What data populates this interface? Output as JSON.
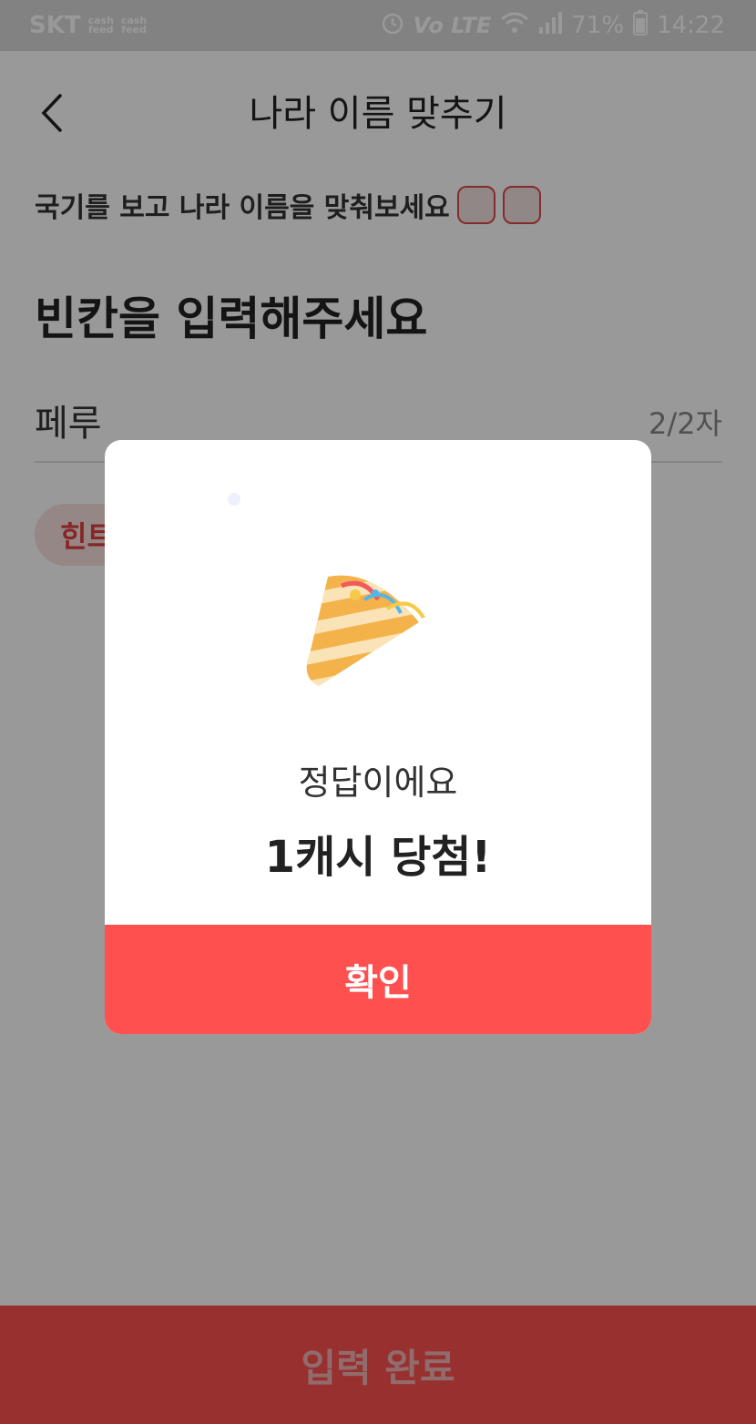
{
  "status_bar": {
    "carrier": "SKT",
    "mini1": "cash\nfeed",
    "mini2": "cash\nfeed",
    "network": "Vo LTE",
    "battery": "71%",
    "time": "14:22"
  },
  "header": {
    "title": "나라 이름 맞추기"
  },
  "quiz": {
    "instruction": "국기를 보고 나라 이름을 맞춰보세요",
    "prompt": "빈칸을 입력해주세요",
    "answer": "페루",
    "counter": "2/2자",
    "hint": "힌트"
  },
  "bottom": {
    "submit_label": "입력 완료"
  },
  "modal": {
    "subtitle": "정답이에요",
    "title": "1캐시 당첨!",
    "confirm_label": "확인",
    "icon": "party-popper-icon"
  },
  "colors": {
    "accent": "#ff5050",
    "dim": "rgba(0,0,0,0.40)"
  }
}
